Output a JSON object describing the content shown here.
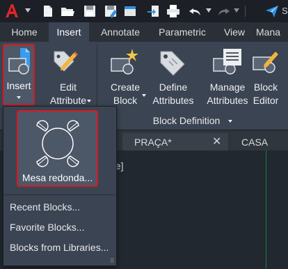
{
  "quick_access": {
    "trail_text": "S"
  },
  "ribbon_tabs": [
    {
      "label": "Home"
    },
    {
      "label": "Insert"
    },
    {
      "label": "Annotate"
    },
    {
      "label": "Parametric"
    },
    {
      "label": "View"
    },
    {
      "label": "Mana"
    }
  ],
  "ribbon": {
    "insert_label": "Insert",
    "edit_attribute_line1": "Edit",
    "edit_attribute_line2": "Attribute",
    "create_block_line1": "Create",
    "create_block_line2": "Block",
    "define_attributes_line1": "Define",
    "define_attributes_line2": "Attributes",
    "manage_attributes_line1": "Manage",
    "manage_attributes_line2": "Attributes",
    "block_editor_line1": "Block",
    "block_editor_line2": "Editor",
    "panel_title": "Block Definition"
  },
  "doc_tabs": [
    {
      "label": "PRAÇA*"
    },
    {
      "label": "CASA POP"
    }
  ],
  "drawing": {
    "bracket_text": "ne]"
  },
  "dropdown": {
    "block_name": "Mesa redonda...",
    "menu": [
      {
        "label": "Recent Blocks..."
      },
      {
        "label": "Favorite Blocks..."
      },
      {
        "label": "Blocks from Libraries..."
      }
    ]
  },
  "colors": {
    "highlight": "#d81b21",
    "ribbon_bg": "#3b4452",
    "accent_blue": "#2f8fe0"
  }
}
